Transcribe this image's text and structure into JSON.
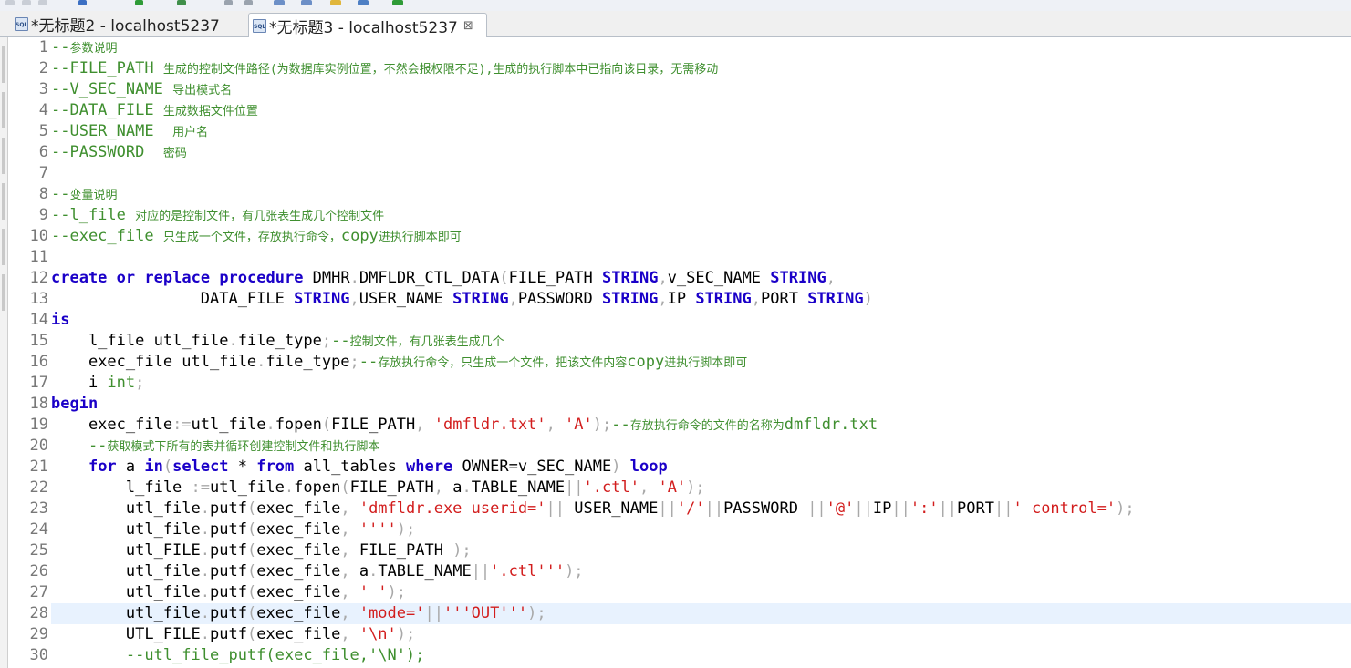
{
  "tabs": [
    {
      "label": "*无标题2 - localhost5237",
      "active": false
    },
    {
      "label": "*无标题3 - localhost5237",
      "active": true
    }
  ],
  "editor": {
    "current_line": 28,
    "lines": [
      {
        "num": "1",
        "tokens": [
          [
            "c",
            "--"
          ],
          [
            "cz",
            "参数说明"
          ]
        ]
      },
      {
        "num": "2",
        "tokens": [
          [
            "c",
            "--FILE_PATH "
          ],
          [
            "cz",
            "生成的控制文件路径(为数据库实例位置，不然会报权限不足),生成的执行脚本中已指向该目录，无需移动"
          ]
        ]
      },
      {
        "num": "3",
        "tokens": [
          [
            "c",
            "--V_SEC_NAME "
          ],
          [
            "cz",
            "导出模式名"
          ]
        ]
      },
      {
        "num": "4",
        "tokens": [
          [
            "c",
            "--DATA_FILE "
          ],
          [
            "cz",
            "生成数据文件位置"
          ]
        ]
      },
      {
        "num": "5",
        "tokens": [
          [
            "c",
            "--USER_NAME  "
          ],
          [
            "cz",
            "用户名"
          ]
        ]
      },
      {
        "num": "6",
        "tokens": [
          [
            "c",
            "--PASSWORD  "
          ],
          [
            "cz",
            "密码"
          ]
        ]
      },
      {
        "num": "7",
        "tokens": []
      },
      {
        "num": "8",
        "tokens": [
          [
            "c",
            "--"
          ],
          [
            "cz",
            "变量说明"
          ]
        ]
      },
      {
        "num": "9",
        "tokens": [
          [
            "c",
            "--l_file "
          ],
          [
            "cz",
            "对应的是控制文件，有几张表生成几个控制文件"
          ]
        ]
      },
      {
        "num": "10",
        "tokens": [
          [
            "c",
            "--exec_file "
          ],
          [
            "cz",
            "只生成一个文件，存放执行命令，"
          ],
          [
            "c",
            "copy"
          ],
          [
            "cz",
            "进执行脚本即可"
          ]
        ]
      },
      {
        "num": "11",
        "tokens": []
      },
      {
        "num": "12",
        "tokens": [
          [
            "k",
            "create"
          ],
          [
            "d",
            " "
          ],
          [
            "k",
            "or"
          ],
          [
            "d",
            " "
          ],
          [
            "k",
            "replace"
          ],
          [
            "d",
            " "
          ],
          [
            "k",
            "procedure"
          ],
          [
            "d",
            " DMHR"
          ],
          [
            "g",
            "."
          ],
          [
            "d",
            "DMFLDR_CTL_DATA"
          ],
          [
            "g",
            "("
          ],
          [
            "d",
            "FILE_PATH "
          ],
          [
            "k",
            "STRING"
          ],
          [
            "g",
            ","
          ],
          [
            "d",
            "v_SEC_NAME "
          ],
          [
            "k",
            "STRING"
          ],
          [
            "g",
            ","
          ]
        ]
      },
      {
        "num": "13",
        "tokens": [
          [
            "d",
            "                DATA_FILE "
          ],
          [
            "k",
            "STRING"
          ],
          [
            "g",
            ","
          ],
          [
            "d",
            "USER_NAME "
          ],
          [
            "k",
            "STRING"
          ],
          [
            "g",
            ","
          ],
          [
            "d",
            "PASSWORD "
          ],
          [
            "k",
            "STRING"
          ],
          [
            "g",
            ","
          ],
          [
            "d",
            "IP "
          ],
          [
            "k",
            "STRING"
          ],
          [
            "g",
            ","
          ],
          [
            "d",
            "PORT "
          ],
          [
            "k",
            "STRING"
          ],
          [
            "g",
            ")"
          ]
        ]
      },
      {
        "num": "14",
        "tokens": [
          [
            "k",
            "is"
          ]
        ]
      },
      {
        "num": "15",
        "tokens": [
          [
            "d",
            "    l_file utl_file"
          ],
          [
            "g",
            "."
          ],
          [
            "d",
            "file_type"
          ],
          [
            "g",
            ";"
          ],
          [
            "c",
            "--"
          ],
          [
            "cz",
            "控制文件，有几张表生成几个"
          ]
        ]
      },
      {
        "num": "16",
        "tokens": [
          [
            "d",
            "    exec_file utl_file"
          ],
          [
            "g",
            "."
          ],
          [
            "d",
            "file_type"
          ],
          [
            "g",
            ";"
          ],
          [
            "c",
            "--"
          ],
          [
            "cz",
            "存放执行命令，只生成一个文件，把该文件内容"
          ],
          [
            "c",
            "copy"
          ],
          [
            "cz",
            "进执行脚本即可"
          ]
        ]
      },
      {
        "num": "17",
        "tokens": [
          [
            "d",
            "    i "
          ],
          [
            "c",
            "int"
          ],
          [
            "g",
            ";"
          ]
        ]
      },
      {
        "num": "18",
        "tokens": [
          [
            "k",
            "begin"
          ]
        ]
      },
      {
        "num": "19",
        "tokens": [
          [
            "d",
            "    exec_file"
          ],
          [
            "g",
            ":="
          ],
          [
            "d",
            "utl_file"
          ],
          [
            "g",
            "."
          ],
          [
            "d",
            "fopen"
          ],
          [
            "g",
            "("
          ],
          [
            "d",
            "FILE_PATH"
          ],
          [
            "g",
            ", "
          ],
          [
            "s",
            "'dmfldr.txt'"
          ],
          [
            "g",
            ", "
          ],
          [
            "s",
            "'A'"
          ],
          [
            "g",
            ");"
          ],
          [
            "c",
            "--"
          ],
          [
            "cz",
            "存放执行命令的文件的名称为"
          ],
          [
            "c",
            "dmfldr.txt"
          ]
        ]
      },
      {
        "num": "20",
        "tokens": [
          [
            "c",
            "    --"
          ],
          [
            "cz",
            "获取模式下所有的表并循环创建控制文件和执行脚本"
          ]
        ]
      },
      {
        "num": "21",
        "tokens": [
          [
            "d",
            "    "
          ],
          [
            "k",
            "for"
          ],
          [
            "d",
            " a "
          ],
          [
            "k",
            "in"
          ],
          [
            "g",
            "("
          ],
          [
            "k",
            "select"
          ],
          [
            "d",
            " * "
          ],
          [
            "k",
            "from"
          ],
          [
            "d",
            " all_tables "
          ],
          [
            "k",
            "where"
          ],
          [
            "d",
            " OWNER=v_SEC_NAME"
          ],
          [
            "g",
            ")"
          ],
          [
            "d",
            " "
          ],
          [
            "k",
            "loop"
          ]
        ]
      },
      {
        "num": "22",
        "tokens": [
          [
            "d",
            "        l_file "
          ],
          [
            "g",
            ":="
          ],
          [
            "d",
            "utl_file"
          ],
          [
            "g",
            "."
          ],
          [
            "d",
            "fopen"
          ],
          [
            "g",
            "("
          ],
          [
            "d",
            "FILE_PATH"
          ],
          [
            "g",
            ", "
          ],
          [
            "d",
            "a"
          ],
          [
            "g",
            "."
          ],
          [
            "d",
            "TABLE_NAME"
          ],
          [
            "g",
            "||"
          ],
          [
            "s",
            "'.ctl'"
          ],
          [
            "g",
            ", "
          ],
          [
            "s",
            "'A'"
          ],
          [
            "g",
            ");"
          ]
        ]
      },
      {
        "num": "23",
        "tokens": [
          [
            "d",
            "        utl_file"
          ],
          [
            "g",
            "."
          ],
          [
            "d",
            "putf"
          ],
          [
            "g",
            "("
          ],
          [
            "d",
            "exec_file"
          ],
          [
            "g",
            ", "
          ],
          [
            "s",
            "'dmfldr.exe userid='"
          ],
          [
            "g",
            "||"
          ],
          [
            "d",
            " USER_NAME"
          ],
          [
            "g",
            "||"
          ],
          [
            "s",
            "'/'"
          ],
          [
            "g",
            "||"
          ],
          [
            "d",
            "PASSWORD "
          ],
          [
            "g",
            "||"
          ],
          [
            "s",
            "'@'"
          ],
          [
            "g",
            "||"
          ],
          [
            "d",
            "IP"
          ],
          [
            "g",
            "||"
          ],
          [
            "s",
            "':'"
          ],
          [
            "g",
            "||"
          ],
          [
            "d",
            "PORT"
          ],
          [
            "g",
            "||"
          ],
          [
            "s",
            "' control='"
          ],
          [
            "g",
            ");"
          ]
        ]
      },
      {
        "num": "24",
        "tokens": [
          [
            "d",
            "        utl_file"
          ],
          [
            "g",
            "."
          ],
          [
            "d",
            "putf"
          ],
          [
            "g",
            "("
          ],
          [
            "d",
            "exec_file"
          ],
          [
            "g",
            ", "
          ],
          [
            "s",
            "''''"
          ],
          [
            "g",
            ");"
          ]
        ]
      },
      {
        "num": "25",
        "tokens": [
          [
            "d",
            "        utl_FILE"
          ],
          [
            "g",
            "."
          ],
          [
            "d",
            "putf"
          ],
          [
            "g",
            "("
          ],
          [
            "d",
            "exec_file"
          ],
          [
            "g",
            ", "
          ],
          [
            "d",
            "FILE_PATH "
          ],
          [
            "g",
            ");"
          ]
        ]
      },
      {
        "num": "26",
        "tokens": [
          [
            "d",
            "        utl_file"
          ],
          [
            "g",
            "."
          ],
          [
            "d",
            "putf"
          ],
          [
            "g",
            "("
          ],
          [
            "d",
            "exec_file"
          ],
          [
            "g",
            ", "
          ],
          [
            "d",
            "a"
          ],
          [
            "g",
            "."
          ],
          [
            "d",
            "TABLE_NAME"
          ],
          [
            "g",
            "||"
          ],
          [
            "s",
            "'.ctl'''"
          ],
          [
            "g",
            ");"
          ]
        ]
      },
      {
        "num": "27",
        "tokens": [
          [
            "d",
            "        utl_file"
          ],
          [
            "g",
            "."
          ],
          [
            "d",
            "putf"
          ],
          [
            "g",
            "("
          ],
          [
            "d",
            "exec_file"
          ],
          [
            "g",
            ", "
          ],
          [
            "s",
            "' '"
          ],
          [
            "g",
            ");"
          ]
        ]
      },
      {
        "num": "28",
        "tokens": [
          [
            "d",
            "        utl_file"
          ],
          [
            "g",
            "."
          ],
          [
            "d",
            "putf"
          ],
          [
            "g",
            "("
          ],
          [
            "d",
            "exec_file"
          ],
          [
            "g",
            ", "
          ],
          [
            "s",
            "'mode='"
          ],
          [
            "g",
            "||"
          ],
          [
            "s",
            "'''OUT'''"
          ],
          [
            "g",
            ");"
          ]
        ]
      },
      {
        "num": "29",
        "tokens": [
          [
            "d",
            "        UTL_FILE"
          ],
          [
            "g",
            "."
          ],
          [
            "d",
            "putf"
          ],
          [
            "g",
            "("
          ],
          [
            "d",
            "exec_file"
          ],
          [
            "g",
            ", "
          ],
          [
            "s",
            "'\\n'"
          ],
          [
            "g",
            ");"
          ]
        ]
      },
      {
        "num": "30",
        "tokens": [
          [
            "c",
            "        --utl_file_putf(exec_file,'\\N');"
          ]
        ]
      }
    ]
  }
}
